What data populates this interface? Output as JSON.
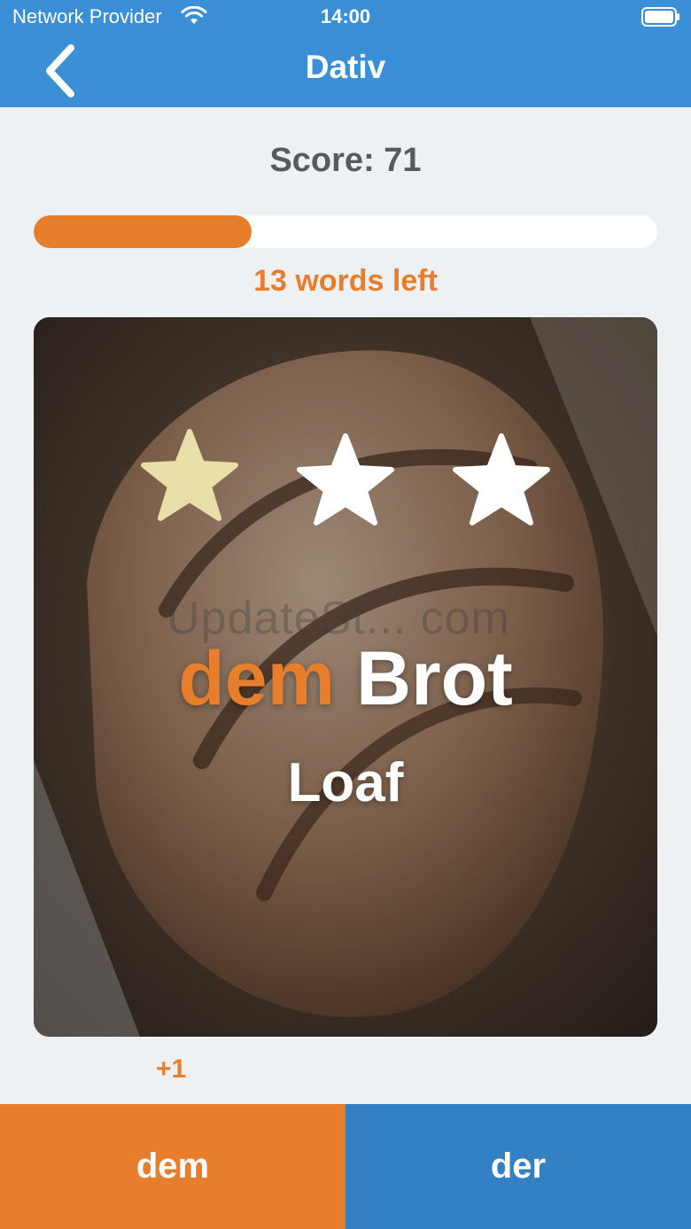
{
  "status_bar": {
    "carrier": "Network Provider",
    "time": "14:00"
  },
  "nav": {
    "title": "Dativ",
    "back_icon": "chevron-left-icon"
  },
  "quiz": {
    "score_text": "Score: 71",
    "progress_fraction": 0.35,
    "words_left_text": "13 words left",
    "stars": {
      "filled": 1,
      "total": 3
    },
    "article": "dem",
    "noun": "Brot",
    "translation": "Loaf",
    "watermark": "UpdateSt... com",
    "points_feedback": "+1"
  },
  "answers": {
    "left_label": "dem",
    "right_label": "der"
  },
  "colors": {
    "header": "#3a8fd6",
    "accent_orange": "#e67e2c",
    "button_blue": "#3381c4",
    "background": "#edf1f3",
    "star_filled": "#e8e0a8",
    "star_empty": "#ffffff"
  }
}
